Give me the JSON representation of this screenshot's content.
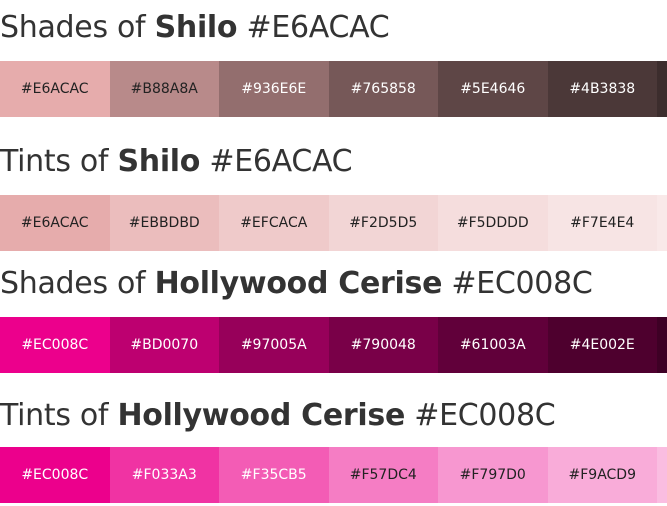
{
  "sections": [
    {
      "prefix": "Shades of",
      "name": "Shilo",
      "hex": "#E6ACAC",
      "swatches": [
        {
          "label": "#E6ACAC",
          "color": "#E6ACAC",
          "text_color": "#222222"
        },
        {
          "label": "#B88A8A",
          "color": "#B88A8A",
          "text_color": "#222222"
        },
        {
          "label": "#936E6E",
          "color": "#936E6E",
          "text_color": "#ffffff"
        },
        {
          "label": "#765858",
          "color": "#765858",
          "text_color": "#ffffff"
        },
        {
          "label": "#5E4646",
          "color": "#5E4646",
          "text_color": "#ffffff"
        },
        {
          "label": "#4B3838",
          "color": "#4B3838",
          "text_color": "#ffffff"
        }
      ],
      "edge_color": "#3C2D2D"
    },
    {
      "prefix": "Tints of",
      "name": "Shilo",
      "hex": "#E6ACAC",
      "swatches": [
        {
          "label": "#E6ACAC",
          "color": "#E6ACAC",
          "text_color": "#222222"
        },
        {
          "label": "#EBBDBD",
          "color": "#EBBDBD",
          "text_color": "#222222"
        },
        {
          "label": "#EFCACA",
          "color": "#EFCACA",
          "text_color": "#222222"
        },
        {
          "label": "#F2D5D5",
          "color": "#F2D5D5",
          "text_color": "#222222"
        },
        {
          "label": "#F5DDDD",
          "color": "#F5DDDD",
          "text_color": "#222222"
        },
        {
          "label": "#F7E4E4",
          "color": "#F7E4E4",
          "text_color": "#222222"
        }
      ],
      "edge_color": "#F9E9E9"
    },
    {
      "prefix": "Shades of",
      "name": "Hollywood Cerise",
      "hex": "#EC008C",
      "swatches": [
        {
          "label": "#EC008C",
          "color": "#EC008C",
          "text_color": "#ffffff"
        },
        {
          "label": "#BD0070",
          "color": "#BD0070",
          "text_color": "#ffffff"
        },
        {
          "label": "#97005A",
          "color": "#97005A",
          "text_color": "#ffffff"
        },
        {
          "label": "#790048",
          "color": "#790048",
          "text_color": "#ffffff"
        },
        {
          "label": "#61003A",
          "color": "#61003A",
          "text_color": "#ffffff"
        },
        {
          "label": "#4E002E",
          "color": "#4E002E",
          "text_color": "#ffffff"
        }
      ],
      "edge_color": "#3E0025"
    },
    {
      "prefix": "Tints of",
      "name": "Hollywood Cerise",
      "hex": "#EC008C",
      "swatches": [
        {
          "label": "#EC008C",
          "color": "#EC008C",
          "text_color": "#ffffff"
        },
        {
          "label": "#F033A3",
          "color": "#F033A3",
          "text_color": "#ffffff"
        },
        {
          "label": "#F35CB5",
          "color": "#F35CB5",
          "text_color": "#ffffff"
        },
        {
          "label": "#F57DC4",
          "color": "#F57DC4",
          "text_color": "#222222"
        },
        {
          "label": "#F797D0",
          "color": "#F797D0",
          "text_color": "#222222"
        },
        {
          "label": "#F9ACD9",
          "color": "#F9ACD9",
          "text_color": "#222222"
        }
      ],
      "edge_color": "#FABDE1"
    }
  ]
}
